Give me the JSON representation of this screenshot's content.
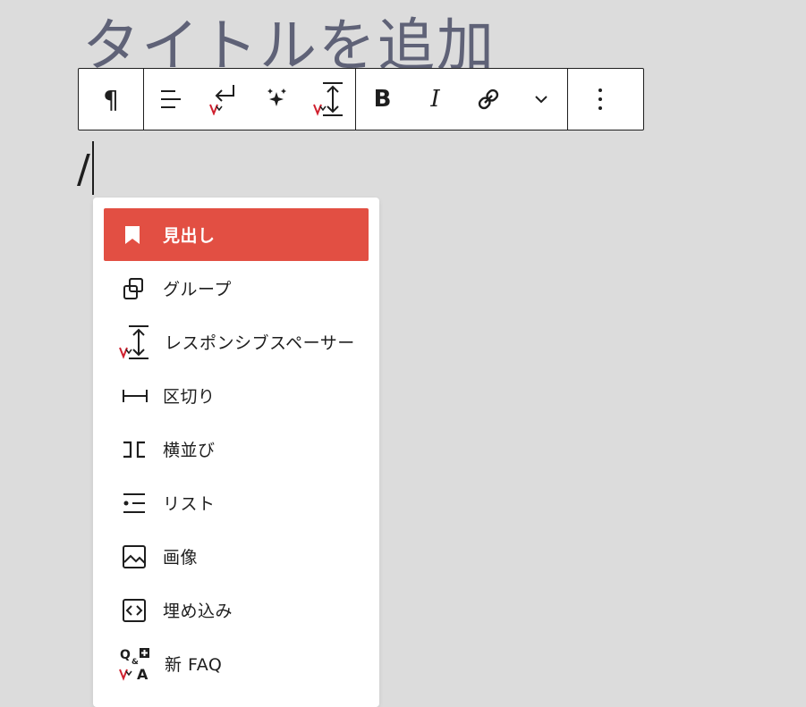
{
  "editor": {
    "title_placeholder": "タイトルを追加",
    "typed_text": "/"
  },
  "toolbar": {
    "paragraph_label": "¶",
    "bold_label": "B",
    "italic_label": "I"
  },
  "menu": {
    "items": [
      {
        "label": "見出し",
        "icon": "bookmark-icon",
        "active": true
      },
      {
        "label": "グループ",
        "icon": "group-icon"
      },
      {
        "label": "レスポンシブスペーサー",
        "icon": "responsive-spacer-icon"
      },
      {
        "label": "区切り",
        "icon": "separator-icon"
      },
      {
        "label": "横並び",
        "icon": "row-icon"
      },
      {
        "label": "リスト",
        "icon": "list-icon"
      },
      {
        "label": "画像",
        "icon": "image-icon"
      },
      {
        "label": "埋め込み",
        "icon": "embed-icon"
      },
      {
        "label": "新 FAQ",
        "icon": "faq-icon"
      }
    ]
  },
  "colors": {
    "background": "#dcdcdc",
    "accent": "#e24f43",
    "badge_red": "#d0202e",
    "text": "#1e1e1e"
  }
}
